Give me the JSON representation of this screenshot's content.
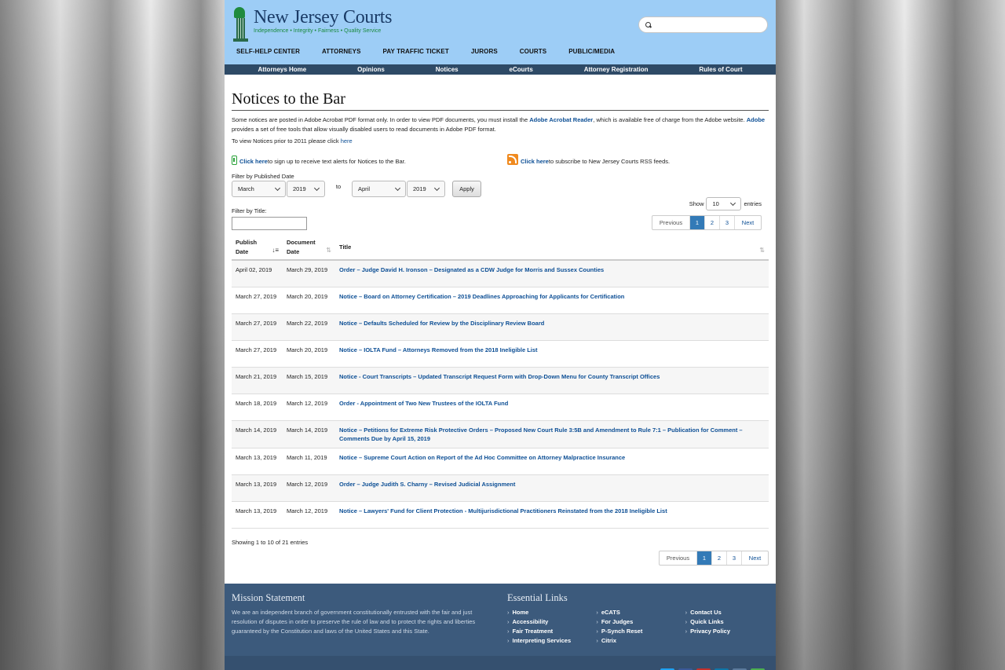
{
  "header": {
    "logo_title": "New Jersey Courts",
    "logo_tagline": "Independence • Integrity • Fairness • Quality Service",
    "search_placeholder": "",
    "main_nav": [
      "SELF-HELP CENTER",
      "ATTORNEYS",
      "PAY TRAFFIC TICKET",
      "JURORS",
      "COURTS",
      "PUBLIC/MEDIA"
    ]
  },
  "subnav": [
    "Attorneys Home",
    "Opinions",
    "Notices",
    "eCourts",
    "Attorney Registration",
    "Rules of Court"
  ],
  "page": {
    "title": "Notices to the Bar",
    "intro_1": "Some notices are posted in Adobe Acrobat PDF format only. In order to view PDF documents, you must install the ",
    "intro_link_1": "Adobe Acrobat Reader",
    "intro_2": ", which is available free of charge from the Adobe website. ",
    "intro_link_2": "Adobe",
    "intro_3": " provides a set of free tools that allow visually disabled users to read documents in Adobe PDF format.",
    "prior_text": "To view Notices prior to 2011 please click ",
    "prior_link": "here",
    "alert_link": "Click here",
    "alert_text": " to sign up to receive text alerts for Notices to the Bar.",
    "rss_link": "Click here",
    "rss_text": " to subscribe to New Jersey Courts RSS feeds."
  },
  "filter": {
    "label": "Filter by Published Date",
    "from_month": "March",
    "from_year": "2019",
    "to_label": "to",
    "to_month": "April",
    "to_year": "2019",
    "apply_label": "Apply",
    "title_label": "Filter by Title:",
    "title_value": ""
  },
  "entries": {
    "show_label": "Show",
    "value": "10",
    "suffix": "entries"
  },
  "pager": {
    "prev": "Previous",
    "pages": [
      "1",
      "2",
      "3"
    ],
    "active": "1",
    "next": "Next"
  },
  "table": {
    "headers": {
      "publish": "Publish Date",
      "document": "Document Date",
      "title": "Title"
    },
    "rows": [
      {
        "publish": "April 02, 2019",
        "document": "March 29, 2019",
        "title": "Order – Judge David H. Ironson – Designated as a CDW Judge for Morris and Sussex Counties"
      },
      {
        "publish": "March 27, 2019",
        "document": "March 20, 2019",
        "title": "Notice – Board on Attorney Certification – 2019 Deadlines Approaching for Applicants for Certification"
      },
      {
        "publish": "March 27, 2019",
        "document": "March 22, 2019",
        "title": "Notice – Defaults Scheduled for Review by the Disciplinary Review Board"
      },
      {
        "publish": "March 27, 2019",
        "document": "March 20, 2019",
        "title": "Notice – IOLTA Fund – Attorneys Removed from the 2018 Ineligible List"
      },
      {
        "publish": "March 21, 2019",
        "document": "March 15, 2019",
        "title": "Notice - Court Transcripts – Updated Transcript Request Form with Drop-Down Menu for County Transcript Offices"
      },
      {
        "publish": "March 18, 2019",
        "document": "March 12, 2019",
        "title": "Order - Appointment of Two New Trustees of the IOLTA Fund"
      },
      {
        "publish": "March 14, 2019",
        "document": "March 14, 2019",
        "title": "Notice – Petitions for Extreme Risk Protective Orders – Proposed New Court Rule 3:5B and Amendment to Rule 7:1 – Publication for Comment – Comments Due by April 15, 2019"
      },
      {
        "publish": "March 13, 2019",
        "document": "March 11, 2019",
        "title": "Notice – Supreme Court Action on Report of the Ad Hoc Committee on Attorney Malpractice Insurance"
      },
      {
        "publish": "March 13, 2019",
        "document": "March 12, 2019",
        "title": "Order – Judge Judith S. Charny – Revised Judicial Assignment"
      },
      {
        "publish": "March 13, 2019",
        "document": "March 12, 2019",
        "title": "Notice – Lawyers' Fund for Client Protection - Multijurisdictional Practitioners Reinstated from the 2018 Ineligible List"
      }
    ]
  },
  "showing": "Showing 1 to 10 of 21 entries",
  "footer": {
    "mission_title": "Mission Statement",
    "mission_text": "We are an independent branch of government constitutionally entrusted with the fair and just resolution of disputes in order to preserve the rule of law and to protect the rights and liberties guaranteed by the Constitution and laws of the United States and this State.",
    "links_title": "Essential Links",
    "links": [
      [
        "Home",
        "Accessibility",
        "Fair Treatment",
        "Interpreting Services"
      ],
      [
        "eCATS",
        "For Judges",
        "P-Synch Reset",
        "Citrix"
      ],
      [
        "Contact Us",
        "Quick Links",
        "Privacy Policy"
      ]
    ],
    "social_colors": [
      "#1da1f2",
      "#3b5998",
      "#c4302b",
      "#0e76a8",
      "#5b7a9c",
      "#4caf50"
    ]
  }
}
